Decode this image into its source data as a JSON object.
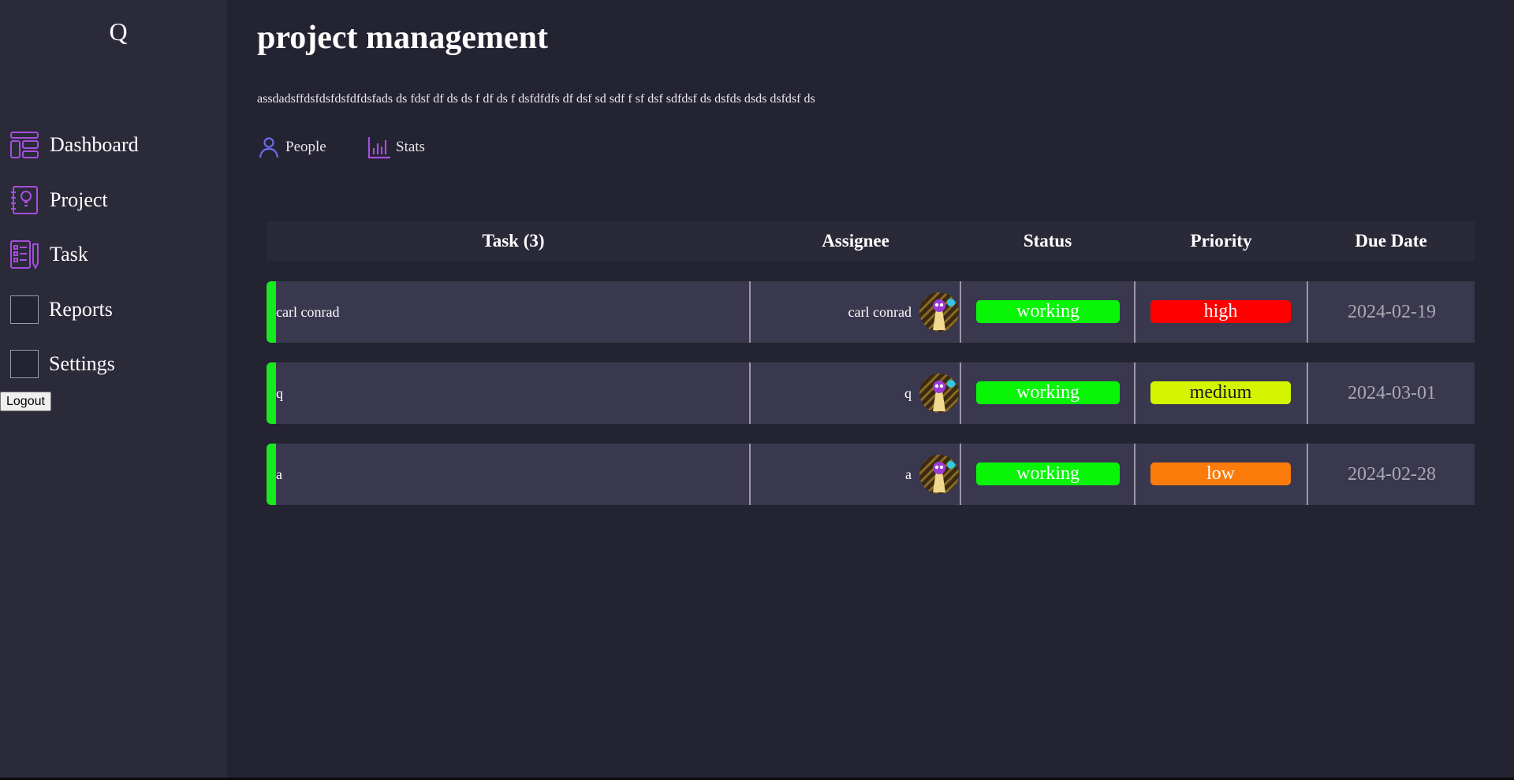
{
  "sidebar": {
    "logo": "Q",
    "items": [
      {
        "label": "Dashboard",
        "icon": "dashboard-icon"
      },
      {
        "label": "Project",
        "icon": "project-icon"
      },
      {
        "label": "Task",
        "icon": "task-icon"
      },
      {
        "label": "Reports",
        "icon": "reports-icon"
      },
      {
        "label": "Settings",
        "icon": "settings-icon"
      }
    ],
    "logout_label": "Logout"
  },
  "main": {
    "title": "project management",
    "description": "assdadsffdsfdsfdsfdfdsfads ds fdsf df ds ds f df ds f dsfdfdfs df dsf sd sdf f sf dsf sdfdsf ds dsfds dsds dsfdsf ds",
    "subnav": [
      {
        "label": "People",
        "icon": "person-icon"
      },
      {
        "label": "Stats",
        "icon": "bar-chart-icon"
      }
    ]
  },
  "table": {
    "headers": {
      "task": "Task (3)",
      "assignee": "Assignee",
      "status": "Status",
      "priority": "Priority",
      "due_date": "Due Date"
    },
    "rows": [
      {
        "task": "carl conrad",
        "assignee": "carl conrad",
        "status": "working",
        "priority": "high",
        "due_date": "2024-02-19"
      },
      {
        "task": "q",
        "assignee": "q",
        "status": "working",
        "priority": "medium",
        "due_date": "2024-03-01"
      },
      {
        "task": "a",
        "assignee": "a",
        "status": "working",
        "priority": "low",
        "due_date": "2024-02-28"
      }
    ]
  },
  "colors": {
    "background": "#242331",
    "sidebar": "#2b2a38",
    "row": "#3a384f",
    "accent_green": "#18e81f",
    "status_working": "#08f508",
    "priority_high": "#ff0000",
    "priority_medium": "#d4f500",
    "priority_low": "#fb7b0b",
    "icon_purple": "#a64ee0"
  }
}
